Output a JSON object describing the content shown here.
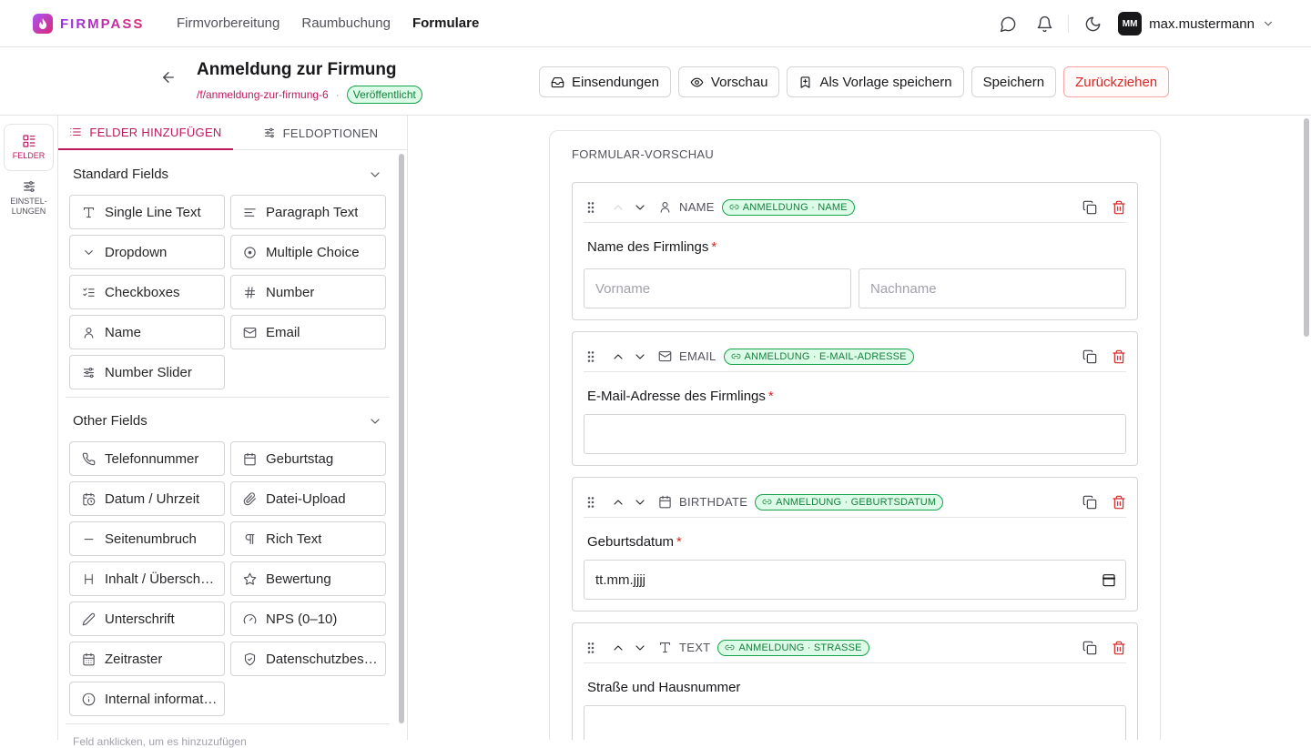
{
  "brand": {
    "name": "FIRMPASS"
  },
  "nav": {
    "links": [
      "Firmvorbereitung",
      "Raumbuchung",
      "Formulare"
    ],
    "active": "Formulare"
  },
  "user": {
    "initials": "MM",
    "name": "max.mustermann"
  },
  "form": {
    "title": "Anmeldung zur Firmung",
    "slug": "/f/anmeldung-zur-firmung-6",
    "separator": "·",
    "status": "Veröffentlicht"
  },
  "actions": {
    "submissions": "Einsendungen",
    "preview": "Vorschau",
    "save_template": "Als Vorlage speichern",
    "save": "Speichern",
    "withdraw": "Zurückziehen"
  },
  "rail": {
    "fields": "FELDER",
    "settings": "EINSTEL-\nLUNGEN"
  },
  "panel": {
    "tab_add": "FELDER HINZUFÜGEN",
    "tab_options": "FELDOPTIONEN",
    "standard_title": "Standard Fields",
    "standard_fields": [
      {
        "label": "Single Line Text",
        "icon": "text-icon"
      },
      {
        "label": "Paragraph Text",
        "icon": "paragraph-icon"
      },
      {
        "label": "Dropdown",
        "icon": "chevron-down-icon"
      },
      {
        "label": "Multiple Choice",
        "icon": "radio-icon"
      },
      {
        "label": "Checkboxes",
        "icon": "checklist-icon"
      },
      {
        "label": "Number",
        "icon": "hash-icon"
      },
      {
        "label": "Name",
        "icon": "user-icon"
      },
      {
        "label": "Email",
        "icon": "mail-icon"
      },
      {
        "label": "Number Slider",
        "icon": "slider-icon"
      }
    ],
    "other_title": "Other Fields",
    "other_fields": [
      {
        "label": "Telefonnummer",
        "icon": "phone-icon"
      },
      {
        "label": "Geburtstag",
        "icon": "calendar-icon"
      },
      {
        "label": "Datum / Uhrzeit",
        "icon": "calendar-clock-icon"
      },
      {
        "label": "Datei-Upload",
        "icon": "paperclip-icon"
      },
      {
        "label": "Seitenumbruch",
        "icon": "minus-icon"
      },
      {
        "label": "Rich Text",
        "icon": "pilcrow-icon"
      },
      {
        "label": "Inhalt / Überschri…",
        "icon": "heading-icon"
      },
      {
        "label": "Bewertung",
        "icon": "star-icon"
      },
      {
        "label": "Unterschrift",
        "icon": "pen-icon"
      },
      {
        "label": "NPS (0–10)",
        "icon": "gauge-icon"
      },
      {
        "label": "Zeitraster",
        "icon": "calendar-grid-icon"
      },
      {
        "label": "Datenschutzbest…",
        "icon": "shield-icon"
      },
      {
        "label": "Internal informati…",
        "icon": "info-icon"
      }
    ],
    "cutoff_text": "Feld anklicken, um es hinzuzufügen"
  },
  "preview": {
    "title": "FORMULAR-VORSCHAU",
    "fields": [
      {
        "type": "NAME",
        "mapping": "ANMELDUNG · NAME",
        "label": "Name des Firmlings",
        "required": true,
        "inputs": [
          "Vorname",
          "Nachname"
        ]
      },
      {
        "type": "EMAIL",
        "mapping": "ANMELDUNG · E-MAIL-ADRESSE",
        "label": "E-Mail-Adresse des Firmlings",
        "required": true,
        "inputs": [
          ""
        ]
      },
      {
        "type": "BIRTHDATE",
        "mapping": "ANMELDUNG · GEBURTSDATUM",
        "label": "Geburtsdatum",
        "required": true,
        "inputs": [
          "tt.mm.jjjj"
        ]
      },
      {
        "type": "TEXT",
        "mapping": "ANMELDUNG · STRASSE",
        "label": "Straße und Hausnummer",
        "required": false,
        "inputs": [
          ""
        ]
      }
    ],
    "required_mark": "*"
  }
}
